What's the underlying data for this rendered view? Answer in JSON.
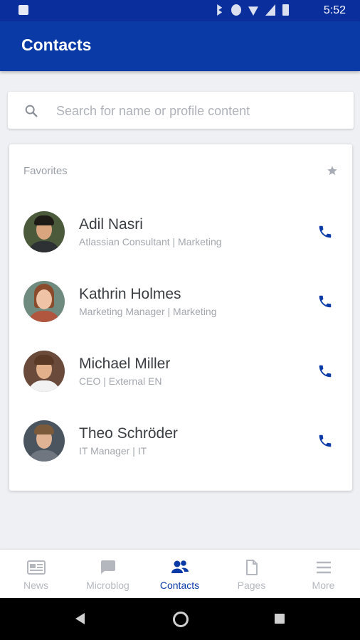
{
  "status_bar": {
    "time": "5:52"
  },
  "app_bar": {
    "title": "Contacts"
  },
  "search": {
    "placeholder": "Search for name or profile content",
    "value": ""
  },
  "favorites": {
    "heading": "Favorites",
    "contacts": [
      {
        "name": "Adil Nasri",
        "role": "Atlassian Consultant | Marketing"
      },
      {
        "name": "Kathrin Holmes",
        "role": "Marketing Manager | Marketing"
      },
      {
        "name": "Michael Miller",
        "role": "CEO | External EN"
      },
      {
        "name": "Theo Schröder",
        "role": "IT Manager | IT"
      }
    ]
  },
  "bottom_nav": {
    "items": [
      {
        "label": "News",
        "icon": "news-icon"
      },
      {
        "label": "Microblog",
        "icon": "chat-icon"
      },
      {
        "label": "Contacts",
        "icon": "contacts-icon",
        "active": true
      },
      {
        "label": "Pages",
        "icon": "page-icon"
      },
      {
        "label": "More",
        "icon": "menu-icon"
      }
    ]
  },
  "colors": {
    "primary": "#0a3aa6",
    "status_bar": "#0a2e9c",
    "inactive": "#b4b8be"
  }
}
